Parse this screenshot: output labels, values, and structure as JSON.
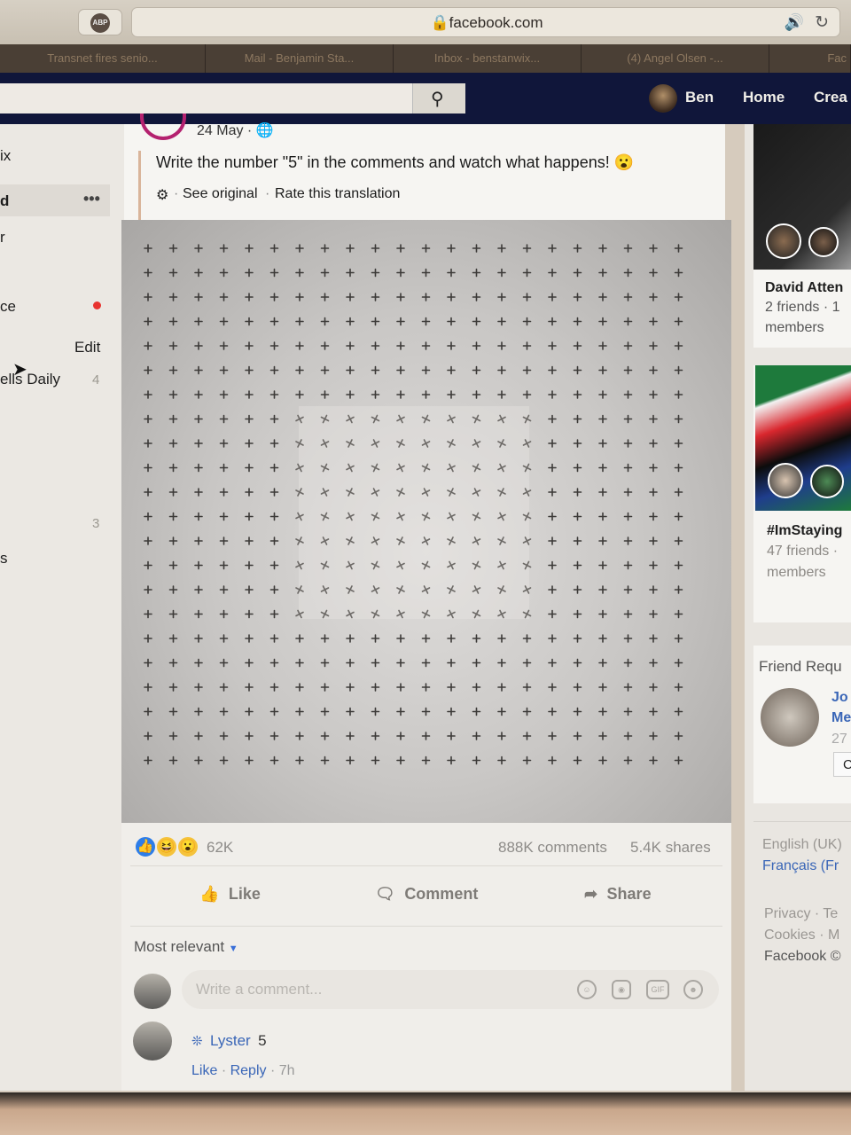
{
  "browser": {
    "adblock_label": "ABP",
    "url": "facebook.com",
    "tabs": [
      {
        "label": "Transnet fires senio..."
      },
      {
        "label": "Mail - Benjamin Sta..."
      },
      {
        "label": "Inbox - benstanwix..."
      },
      {
        "label": "(4) Angel Olsen -..."
      },
      {
        "label": "Fac"
      }
    ]
  },
  "topbar": {
    "search_placeholder": "",
    "user_name": "Ben",
    "home_label": "Home",
    "create_label": "Crea"
  },
  "sidebar": {
    "items": [
      {
        "label": "ix"
      },
      {
        "label": "d",
        "more": "•••"
      },
      {
        "label": "r"
      },
      {
        "label": "ce"
      },
      {
        "label": "Edit"
      },
      {
        "label": "ells Daily",
        "count": "4"
      },
      {
        "count": "3"
      },
      {
        "label": "s"
      }
    ]
  },
  "post": {
    "date": "24 May · ",
    "text": "Write the number \"5\" in the comments and watch what happens! 😮",
    "see_original": "See original",
    "rate_translation": "Rate this translation",
    "reaction_count": "62K",
    "comments_count": "888K comments",
    "shares_count": "5.4K shares",
    "actions": {
      "like": "Like",
      "comment": "Comment",
      "share": "Share"
    },
    "sort_label": "Most relevant",
    "comment_placeholder": "Write a comment...",
    "comment_icons": [
      "smiley-icon",
      "camera-icon",
      "gif-icon",
      "sticker-icon"
    ],
    "gif_text": "GIF",
    "comments": [
      {
        "author": "Lyster",
        "text": "5",
        "like": "Like",
        "reply": "Reply",
        "time": "7h"
      }
    ]
  },
  "right": {
    "group1": {
      "name": "David Atten",
      "line2": "2 friends · 1",
      "line3": "members"
    },
    "group2": {
      "name": "#ImStaying",
      "line2": "47 friends ·",
      "line3": "members"
    },
    "friend_requests": {
      "title": "Friend Requ",
      "name1": "Jo",
      "name2": "Me",
      "mutual": "27",
      "btn": "C"
    },
    "languages": [
      "English (UK)",
      "Français (Fr"
    ],
    "footer": [
      "Privacy · Te",
      "Cookies · M",
      "Facebook ©"
    ]
  }
}
